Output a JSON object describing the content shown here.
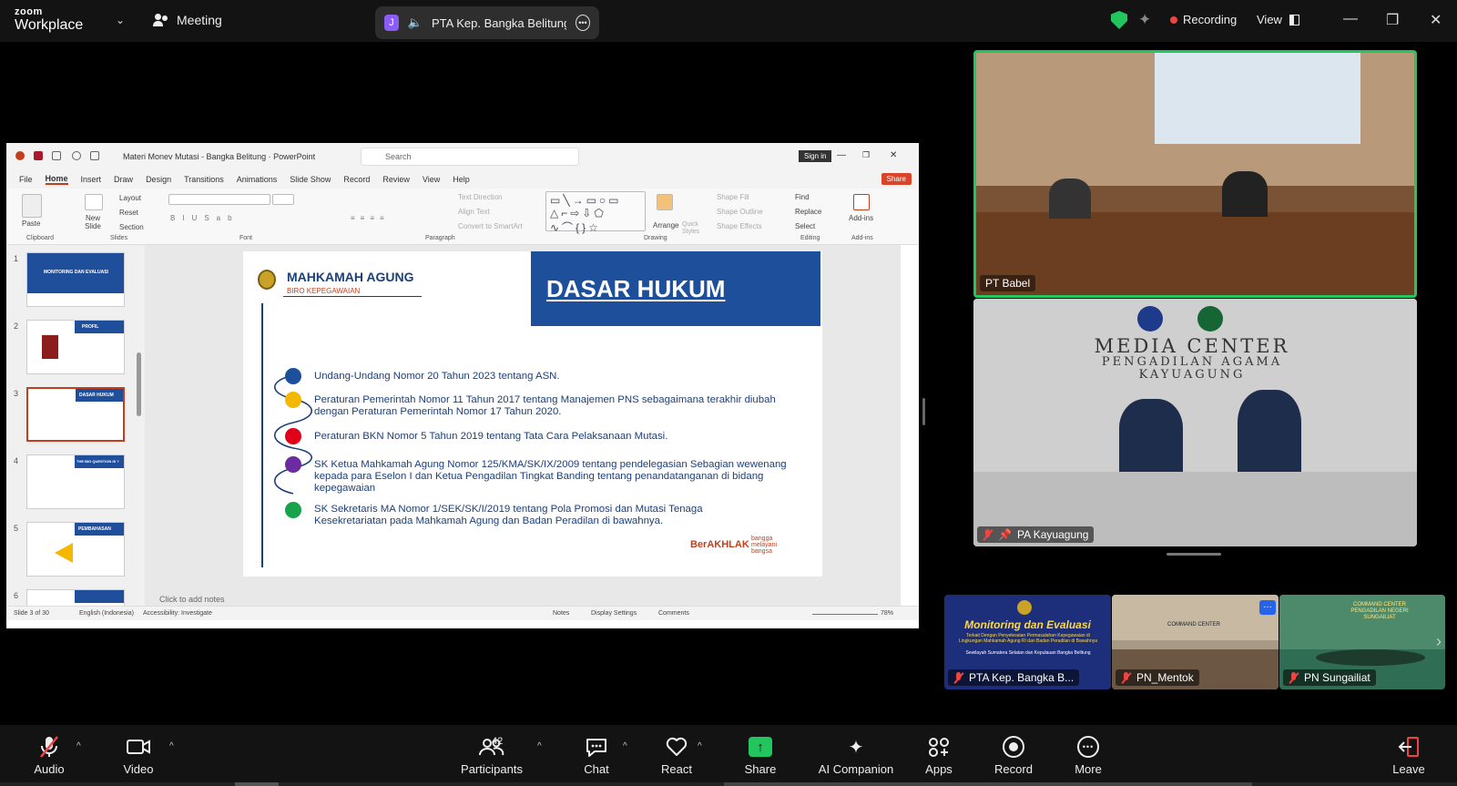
{
  "app": {
    "logo_top": "zoom",
    "logo_bottom": "Workplace",
    "meeting_label": "Meeting"
  },
  "active_speaker": {
    "badge": "J",
    "name": "PTA Kep. Bangka Belitung's :"
  },
  "status": {
    "recording_label": "Recording",
    "view_label": "View"
  },
  "colors": {
    "recording_dot": "#ef4444",
    "shield": "#22c55e",
    "share_accent": "#22c55e",
    "active_speaker_border": "#22c55e",
    "slide_blue": "#1d4f9a",
    "muted_red": "#ef4444"
  },
  "powerpoint": {
    "window_title": "Materi Monev Mutasi - Bangka Belitung  ·  PowerPoint",
    "search_placeholder": "Search",
    "sign_in": "Sign in",
    "share_button": "Share",
    "menu": [
      "File",
      "Home",
      "Insert",
      "Draw",
      "Design",
      "Transitions",
      "Animations",
      "Slide Show",
      "Record",
      "Review",
      "View",
      "Help"
    ],
    "ribbon": {
      "paste": "Paste",
      "new_slide": "New Slide",
      "layout": "Layout",
      "reset": "Reset",
      "section": "Section",
      "text_direction": "Text Direction",
      "align_text": "Align Text",
      "convert_smartart": "Convert to SmartArt",
      "arrange": "Arrange",
      "quick_styles": "Quick Styles",
      "shape_fill": "Shape Fill",
      "shape_outline": "Shape Outline",
      "shape_effects": "Shape Effects",
      "find": "Find",
      "replace": "Replace",
      "select": "Select",
      "addins": "Add-ins",
      "groups": [
        "Clipboard",
        "Slides",
        "Font",
        "Paragraph",
        "Drawing",
        "Editing",
        "Add-ins"
      ]
    },
    "thumbnails": [
      {
        "num": "1",
        "title": "MONITORING DAN EVALUASI"
      },
      {
        "num": "2",
        "title": "PROFIL"
      },
      {
        "num": "3",
        "title": "DASAR HUKUM"
      },
      {
        "num": "4",
        "title": "THE BIG QUESTION IS ?"
      },
      {
        "num": "5",
        "title": "PEMBAHASAN"
      },
      {
        "num": "6",
        "title": ""
      }
    ],
    "notes_placeholder": "Click to add notes",
    "status": {
      "slide": "Slide 3 of 30",
      "language": "English (Indonesia)",
      "accessibility": "Accessibility: Investigate",
      "notes": "Notes",
      "display_settings": "Display Settings",
      "comments": "Comments",
      "zoom": "78%"
    }
  },
  "slide": {
    "org": "MAHKAMAH AGUNG",
    "org_sub": "BIRO KEPEGAWAIAN",
    "heading": "DASAR HUKUM",
    "items": [
      "Undang-Undang Nomor 20 Tahun 2023 tentang ASN.",
      "Peraturan Pemerintah Nomor 11 Tahun 2017 tentang Manajemen PNS sebagaimana terakhir diubah dengan Peraturan Pemerintah Nomor 17 Tahun 2020.",
      "Peraturan BKN Nomor 5 Tahun 2019 tentang Tata Cara Pelaksanaan Mutasi.",
      "SK Ketua Mahkamah Agung Nomor 125/KMA/SK/IX/2009 tentang pendelegasian Sebagian wewenang kepada para Eselon I dan Ketua Pengadilan Tingkat Banding tentang penandatanganan di bidang kepegawaian",
      "SK Sekretaris MA Nomor 1/SEK/SK/I/2019 tentang Pola Promosi dan Mutasi Tenaga Kesekretariatan pada Mahkamah Agung dan Badan Peradilan di bawahnya."
    ],
    "dot_colors": [
      "#1d4f9a",
      "#f5b800",
      "#e0001a",
      "#6a2ca0",
      "#17a34a"
    ],
    "logo_berakhlak": "BerAKHLAK",
    "logo_bangga": "bangga melayani bangsa"
  },
  "participants_videos": {
    "pt_babel": "PT Babel",
    "pa_kayuagung": "PA Kayuagung",
    "media_center_sign": "MEDIA CENTER",
    "media_center_sign2": "PENGADILAN AGAMA",
    "media_center_sign3": "KAYUAGUNG",
    "strip": [
      {
        "name": "PTA Kep. Bangka B...",
        "banner_title": "Monitoring dan Evaluasi",
        "banner_sub": "Terkait Dengan Penyelesaian Permasalahan Kepegawaian di Lingkungan Mahkamah Agung RI dan Badan Peradilan di Bawahnya",
        "banner_sub2": "Sewilayah Sumatera Selatan dan Kepulauan Bangka Belitung"
      },
      {
        "name": "PN_Mentok",
        "sign": "COMMAND CENTER"
      },
      {
        "name": "PN Sungailiat",
        "sign": "COMMAND CENTER PENGADILAN NEGERI SUNGAILIAT"
      }
    ]
  },
  "toolbar": {
    "audio": "Audio",
    "video": "Video",
    "participants": "Participants",
    "participant_count": "42",
    "chat": "Chat",
    "react": "React",
    "share": "Share",
    "ai_companion": "AI Companion",
    "apps": "Apps",
    "record": "Record",
    "more": "More",
    "leave": "Leave"
  }
}
